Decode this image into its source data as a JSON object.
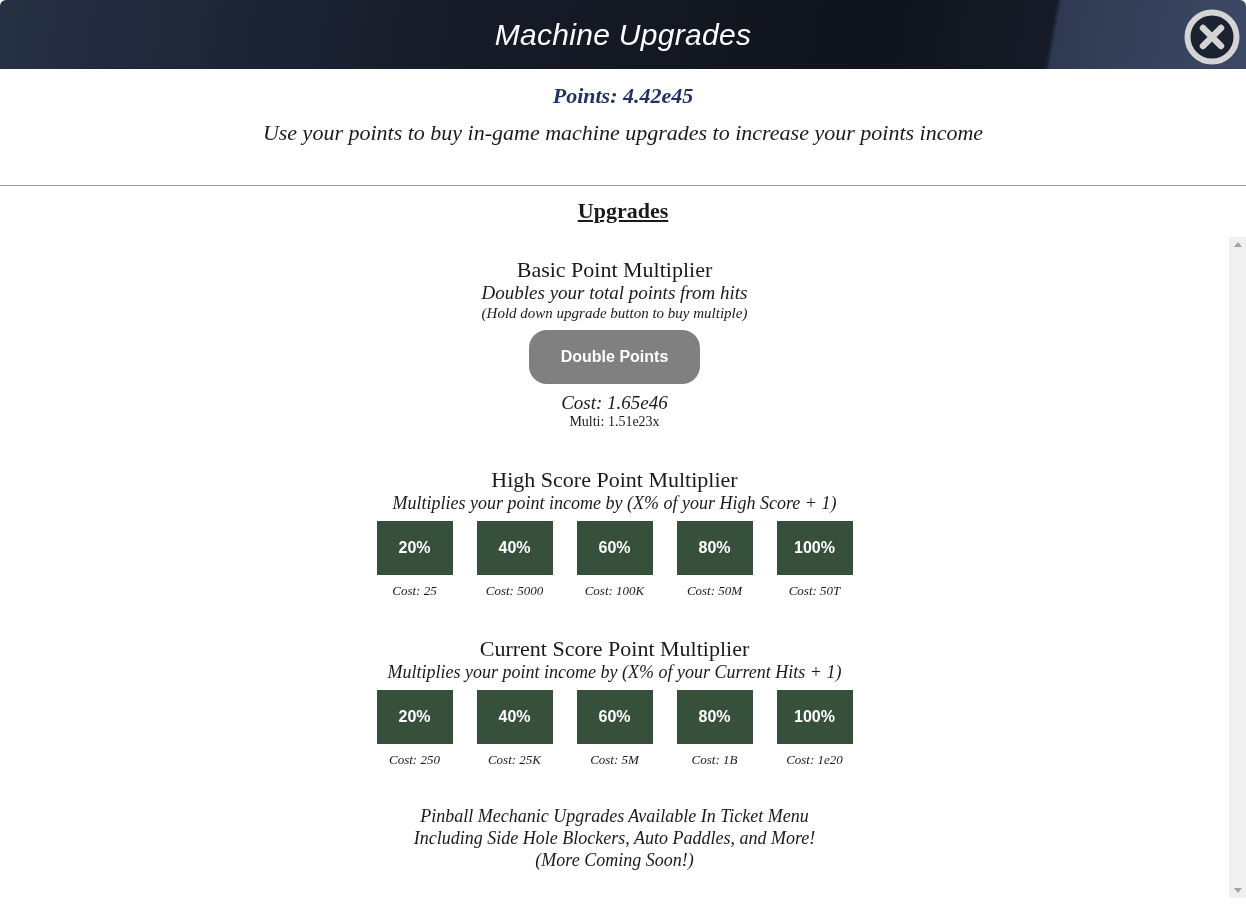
{
  "window": {
    "title": "Machine Upgrades"
  },
  "summary": {
    "points": "Points: 4.42e45",
    "description": "Use your points to buy in-game machine upgrades to increase your points income"
  },
  "section_heading": "Upgrades",
  "upgrades": [
    {
      "kind": "single",
      "title": "Basic Point Multiplier",
      "description": "Doubles your total points from hits",
      "note": "(Hold down upgrade button to buy multiple)",
      "button": {
        "label": "Double Points",
        "disabled": true
      },
      "cost": "Cost: 1.65e46",
      "multi": "Multi: 1.51e23x"
    },
    {
      "kind": "tiers",
      "title": "High Score Point Multiplier",
      "description": "Multiplies your point income by (X% of your High Score + 1)",
      "tiers": [
        {
          "label": "20%",
          "cost": "Cost: 25"
        },
        {
          "label": "40%",
          "cost": "Cost: 5000"
        },
        {
          "label": "60%",
          "cost": "Cost: 100K"
        },
        {
          "label": "80%",
          "cost": "Cost: 50M"
        },
        {
          "label": "100%",
          "cost": "Cost: 50T"
        }
      ]
    },
    {
      "kind": "tiers",
      "title": "Current Score Point Multiplier",
      "description": "Multiplies your point income by (X% of your Current Hits + 1)",
      "tiers": [
        {
          "label": "20%",
          "cost": "Cost: 250"
        },
        {
          "label": "40%",
          "cost": "Cost: 25K"
        },
        {
          "label": "60%",
          "cost": "Cost: 5M"
        },
        {
          "label": "80%",
          "cost": "Cost: 1B"
        },
        {
          "label": "100%",
          "cost": "Cost: 1e20"
        }
      ]
    }
  ],
  "footer": {
    "lines": [
      "Pinball Mechanic Upgrades Available In Ticket Menu",
      "Including Side Hole Blockers, Auto Paddles, and More!",
      "(More Coming Soon!)"
    ]
  }
}
